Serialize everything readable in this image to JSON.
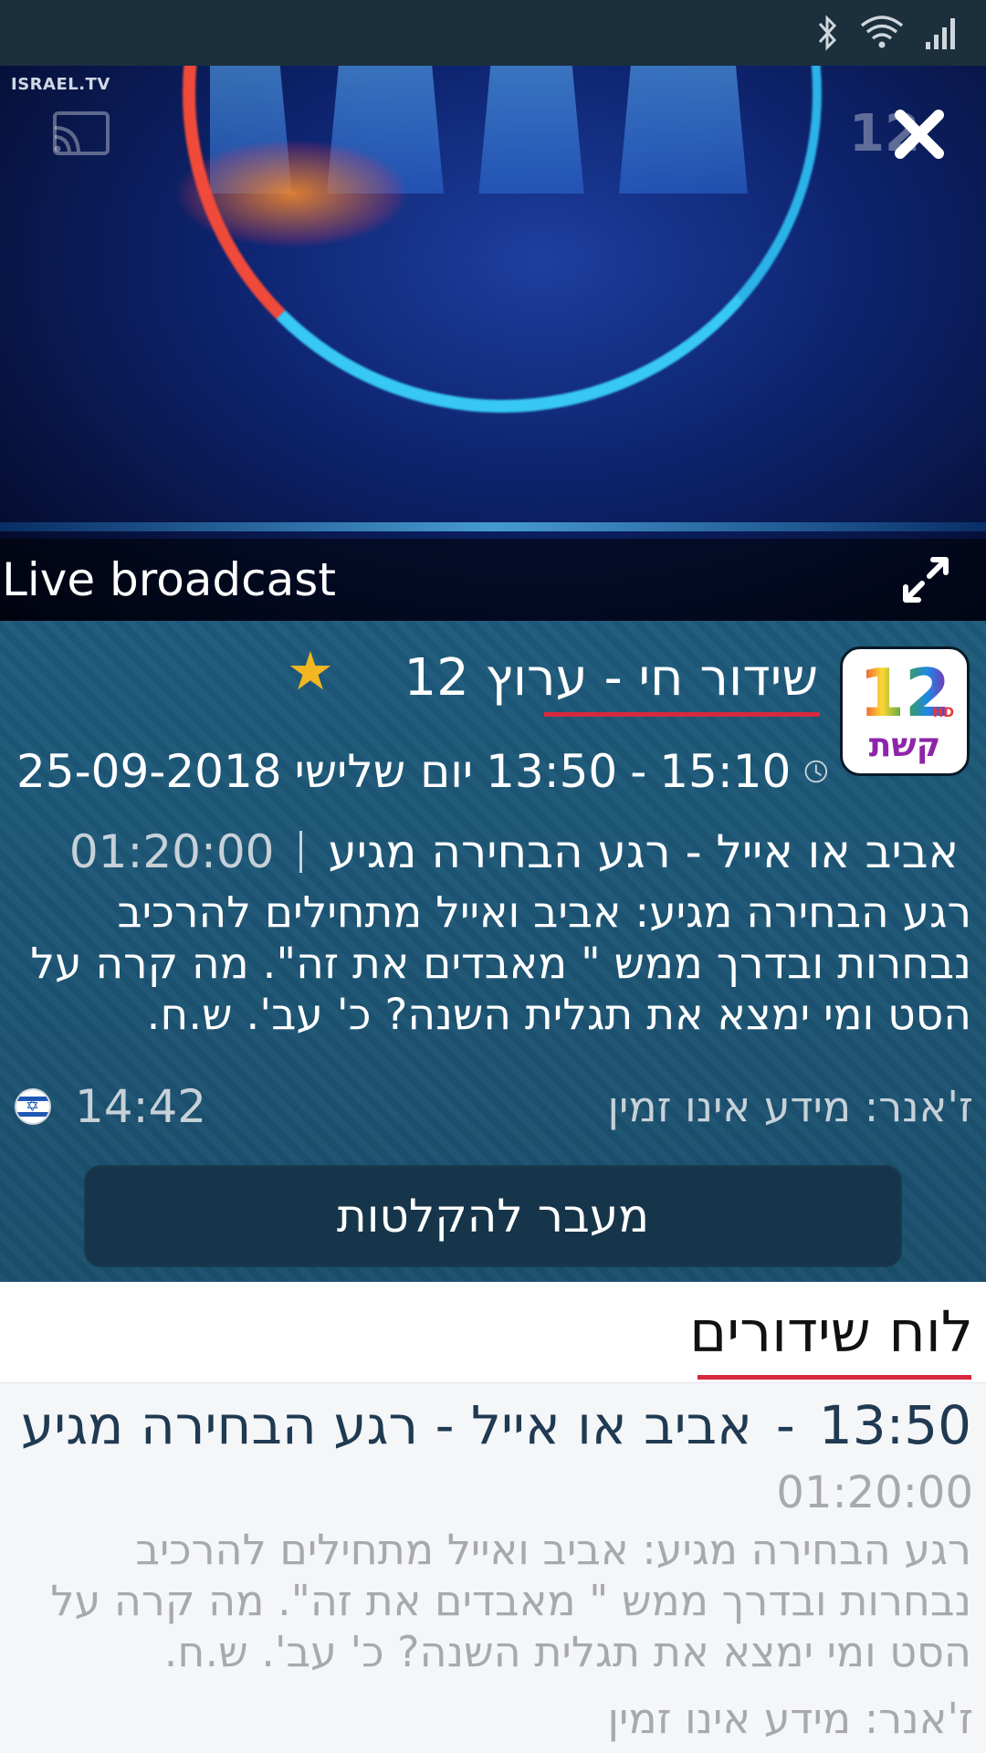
{
  "status_bar": {
    "icons": [
      "bluetooth-icon",
      "wifi-icon",
      "signal-icon"
    ]
  },
  "player": {
    "watermark": "ISRAEL.TV",
    "channel_watermark": "12",
    "live_label": "Live broadcast"
  },
  "channel": {
    "logo_number": "12",
    "logo_hd": "HD",
    "logo_name": "קשת",
    "title": "שידור חי - ערוץ 12",
    "favorite": true,
    "accent_color": "#d8283e",
    "star_color": "#f2b720"
  },
  "now": {
    "end_time": "15:10",
    "start_time": "13:50",
    "day": "יום שלישי",
    "date": "25-09-2018",
    "program": "אביב או אייל - רגע הבחירה מגיע",
    "duration": "01:20:00",
    "description": "רגע הבחירה מגיע: אביב ואייל מתחילים להרכיב נבחרות ובדרך ממש \" מאבדים את זה\". מה קרה על הסט ומי ימצא את תגלית השנה? כ' עב'. ש.ח.",
    "genre": "ז'אנר: מידע אינו זמין",
    "clock": "14:42"
  },
  "actions": {
    "recordings_label": "מעבר להקלטות"
  },
  "schedule": {
    "title": "לוח שידורים",
    "items": [
      {
        "time": "13:50",
        "dash": "-",
        "name": "אביב או אייל - רגע הבחירה מגיע",
        "duration": "01:20:00",
        "description": "רגע הבחירה מגיע: אביב ואייל מתחילים להרכיב נבחרות ובדרך ממש \" מאבדים את זה\". מה קרה על הסט ומי ימצא את תגלית השנה? כ' עב'. ש.ח.",
        "genre": "ז'אנר: מידע אינו זמין"
      }
    ]
  }
}
